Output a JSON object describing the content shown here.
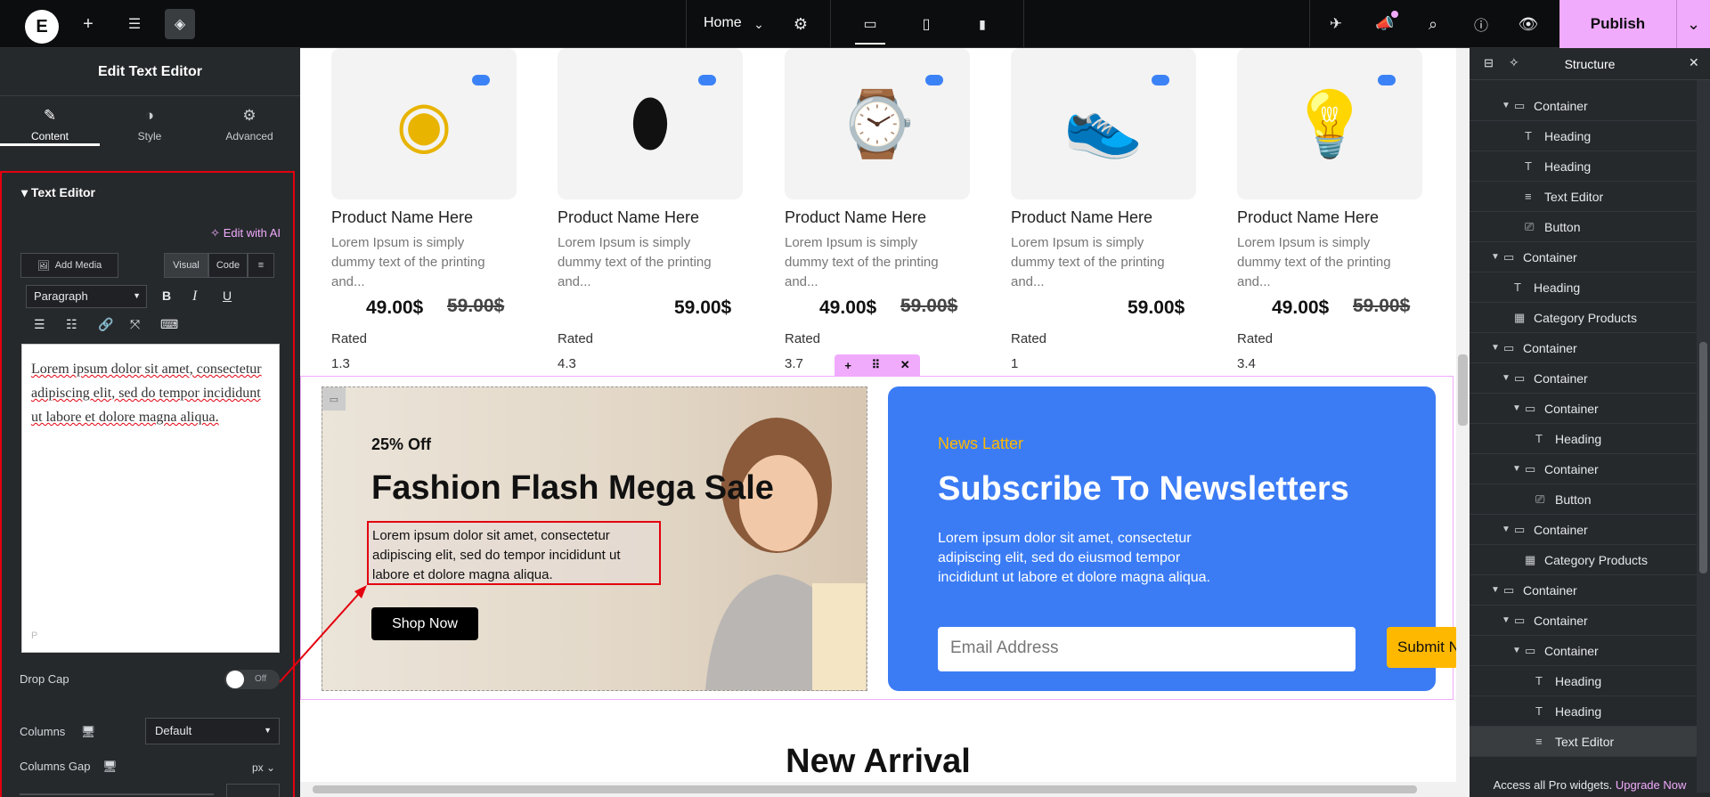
{
  "topbar": {
    "page_name": "Home",
    "publish_label": "Publish"
  },
  "left_panel": {
    "title": "Edit Text Editor",
    "tabs": [
      {
        "label": "Content"
      },
      {
        "label": "Style"
      },
      {
        "label": "Advanced"
      }
    ],
    "section_title": "Text Editor",
    "edit_ai_label": "Edit with AI",
    "add_media_label": "Add Media",
    "visual_label": "Visual",
    "code_label": "Code",
    "format_select": "Paragraph",
    "bold": "B",
    "italic": "I",
    "underline": "U",
    "editor_text": "Lorem ipsum dolor sit amet, consectetur adipiscing elit, sed do tempor incididunt ut labore et dolore magna aliqua.",
    "editor_path": "P",
    "drop_cap_label": "Drop Cap",
    "drop_cap_value": "Off",
    "columns_label": "Columns",
    "columns_value": "Default",
    "columns_gap_label": "Columns Gap",
    "columns_gap_unit": "px"
  },
  "products": [
    {
      "name": "Product Name Here",
      "desc": "Lorem Ipsum is simply dummy text of the printing and...",
      "price": "49.00$",
      "old_price": "59.00$",
      "rated_label": "Rated",
      "rating": "1.3",
      "icon": "speaker-icon"
    },
    {
      "name": "Product Name Here",
      "desc": "Lorem Ipsum is simply dummy text of the printing and...",
      "price": "59.00$",
      "old_price": "",
      "rated_label": "Rated",
      "rating": "4.3",
      "icon": "mouse-icon"
    },
    {
      "name": "Product Name Here",
      "desc": "Lorem Ipsum is simply dummy text of the printing and...",
      "price": "49.00$",
      "old_price": "59.00$",
      "rated_label": "Rated",
      "rating": "3.7",
      "icon": "watch-icon"
    },
    {
      "name": "Product Name Here",
      "desc": "Lorem Ipsum is simply dummy text of the printing and...",
      "price": "59.00$",
      "old_price": "",
      "rated_label": "Rated",
      "rating": "1",
      "icon": "sneaker-icon"
    },
    {
      "name": "Product Name Here",
      "desc": "Lorem Ipsum is simply dummy text of the printing and...",
      "price": "49.00$",
      "old_price": "59.00$",
      "rated_label": "Rated",
      "rating": "3.4",
      "icon": "lamp-icon"
    }
  ],
  "promo": {
    "discount": "25% Off",
    "heading": "Fashion Flash Mega Sale",
    "text": "Lorem ipsum dolor sit amet, consectetur adipiscing elit, sed do tempor incididunt ut labore et dolore magna aliqua.",
    "button": "Shop Now"
  },
  "newsletter": {
    "kicker": "News Latter",
    "heading": "Subscribe To Newsletters",
    "text": "Lorem ipsum dolor sit amet, consectetur adipiscing elit, sed do eiusmod tempor incididunt ut labore et dolore magna aliqua.",
    "email_placeholder": "Email Address",
    "submit_label": "Submit N"
  },
  "new_arrival": "New Arrival",
  "structure": {
    "title": "Structure",
    "items": [
      {
        "label": "Container",
        "type": "container",
        "depth": 2,
        "expanded": true
      },
      {
        "label": "Heading",
        "type": "heading",
        "depth": 3
      },
      {
        "label": "Heading",
        "type": "heading",
        "depth": 3
      },
      {
        "label": "Text Editor",
        "type": "text",
        "depth": 3
      },
      {
        "label": "Button",
        "type": "button",
        "depth": 3
      },
      {
        "label": "Container",
        "type": "container",
        "depth": 1,
        "expanded": true
      },
      {
        "label": "Heading",
        "type": "heading",
        "depth": 2
      },
      {
        "label": "Category Products",
        "type": "grid",
        "depth": 2
      },
      {
        "label": "Container",
        "type": "container",
        "depth": 1,
        "expanded": true
      },
      {
        "label": "Container",
        "type": "container",
        "depth": 2,
        "expanded": true
      },
      {
        "label": "Container",
        "type": "container",
        "depth": 3,
        "expanded": true
      },
      {
        "label": "Heading",
        "type": "heading",
        "depth": 4
      },
      {
        "label": "Container",
        "type": "container",
        "depth": 3,
        "expanded": true
      },
      {
        "label": "Button",
        "type": "button",
        "depth": 4
      },
      {
        "label": "Container",
        "type": "container",
        "depth": 2,
        "expanded": true
      },
      {
        "label": "Category Products",
        "type": "grid",
        "depth": 3
      },
      {
        "label": "Container",
        "type": "container",
        "depth": 1,
        "expanded": true
      },
      {
        "label": "Container",
        "type": "container",
        "depth": 2,
        "expanded": true
      },
      {
        "label": "Container",
        "type": "container",
        "depth": 3,
        "expanded": true
      },
      {
        "label": "Heading",
        "type": "heading",
        "depth": 4
      },
      {
        "label": "Heading",
        "type": "heading",
        "depth": 4
      },
      {
        "label": "Text Editor",
        "type": "text",
        "depth": 4,
        "selected": true
      }
    ],
    "footer_text": "Access all Pro widgets.",
    "footer_link": "Upgrade Now"
  },
  "colors": {
    "publish": "#f0abfc",
    "accent_blue": "#3b7cf5",
    "highlight": "#e3000f",
    "newsletter_kicker": "#ffb800"
  }
}
